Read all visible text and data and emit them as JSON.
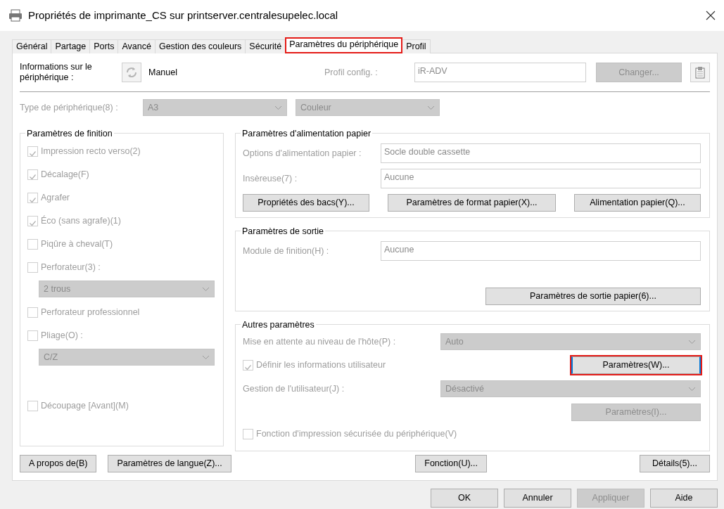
{
  "window": {
    "title": "Propriétés de imprimante_CS sur printserver.centralesupelec.local"
  },
  "tabs": [
    {
      "label": "Général",
      "selected": false,
      "highlighted": false
    },
    {
      "label": "Partage",
      "selected": false,
      "highlighted": false
    },
    {
      "label": "Ports",
      "selected": false,
      "highlighted": false
    },
    {
      "label": "Avancé",
      "selected": false,
      "highlighted": false
    },
    {
      "label": "Gestion des couleurs",
      "selected": false,
      "highlighted": false
    },
    {
      "label": "Sécurité",
      "selected": false,
      "highlighted": false
    },
    {
      "label": "Paramètres du périphérique",
      "selected": true,
      "highlighted": true
    },
    {
      "label": "Profil",
      "selected": false,
      "highlighted": false
    }
  ],
  "device_info": {
    "label": "Informations sur le périphérique :",
    "mode": "Manuel",
    "profile_label": "Profil config. :",
    "profile_value": "iR-ADV",
    "change_button": {
      "label": "Changer...",
      "disabled": true
    }
  },
  "device_type": {
    "label": "Type de périphérique(8) :",
    "paper_size": "A3",
    "color_mode": "Couleur"
  },
  "finishing": {
    "title": "Paramètres de finition",
    "items": [
      {
        "kind": "checkbox",
        "label": "Impression recto verso(2)",
        "checked": true
      },
      {
        "kind": "checkbox",
        "label": "Décalage(F)",
        "checked": true
      },
      {
        "kind": "checkbox",
        "label": "Agrafer",
        "checked": true
      },
      {
        "kind": "checkbox",
        "label": "Éco (sans agrafe)(1)",
        "checked": true
      },
      {
        "kind": "checkbox",
        "label": "Piqûre à cheval(T)",
        "checked": false
      },
      {
        "kind": "checkbox",
        "label": "Perforateur(3) :",
        "checked": false
      },
      {
        "kind": "dropdown",
        "value": "2 trous"
      },
      {
        "kind": "checkbox",
        "label": "Perforateur professionnel",
        "checked": false
      },
      {
        "kind": "checkbox",
        "label": "Pliage(O) :",
        "checked": false
      },
      {
        "kind": "dropdown",
        "value": "C/Z"
      },
      {
        "kind": "checkbox",
        "label": "Découpage [Avant](M)",
        "checked": false
      }
    ]
  },
  "paper_feed": {
    "title": "Paramètres d'alimentation papier",
    "fields": [
      {
        "label": "Options d'alimentation papier :",
        "value": "Socle double cassette"
      },
      {
        "label": "Insèreuse(7) :",
        "value": "Aucune"
      }
    ],
    "buttons": [
      "Propriétés des bacs(Y)...",
      "Paramètres de format papier(X)...",
      "Alimentation papier(Q)..."
    ]
  },
  "output": {
    "title": "Paramètres de sortie",
    "fields": [
      {
        "label": "Module de finition(H) :",
        "value": "Aucune"
      }
    ],
    "button": "Paramètres de sortie papier(6)..."
  },
  "other": {
    "title": "Autres paramètres",
    "rows": [
      {
        "kind": "dropdown",
        "label": "Mise en attente au niveau de l'hôte(P) :",
        "value": "Auto"
      },
      {
        "kind": "checkbox",
        "label": "Définir les informations utilisateur",
        "checked": true,
        "button": {
          "label": "Paramètres(W)...",
          "disabled": false,
          "highlighted": true
        }
      },
      {
        "kind": "dropdown",
        "label": "Gestion de l'utilisateur(J) :",
        "value": "Désactivé"
      },
      {
        "kind": "button",
        "button": {
          "label": "Paramètres(I)...",
          "disabled": true,
          "highlighted": false
        }
      },
      {
        "kind": "checkbox",
        "label": "Fonction d'impression sécurisée du périphérique(V)",
        "checked": false
      }
    ]
  },
  "panel_buttons": [
    "A propos de(B)",
    "Paramètres de langue(Z)...",
    "Fonction(U)...",
    "Détails(5)..."
  ],
  "dialog_buttons": [
    {
      "label": "OK",
      "disabled": false
    },
    {
      "label": "Annuler",
      "disabled": false
    },
    {
      "label": "Appliquer",
      "disabled": true
    },
    {
      "label": "Aide",
      "disabled": false
    }
  ]
}
